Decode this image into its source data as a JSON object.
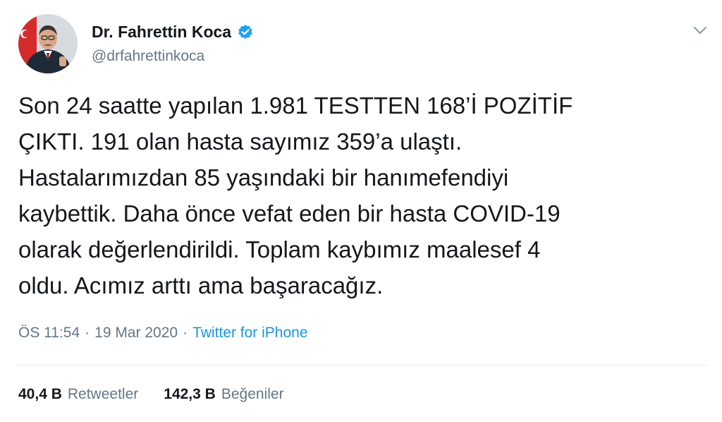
{
  "tweet": {
    "author_name": "Dr. Fahrettin Koca",
    "author_handle": "@drfahrettinkoca",
    "text": "Son 24 saatte yapılan 1.981 TESTTEN 168’İ POZİTİF\nÇIKTI. 191 olan hasta sayımız 359’a ulaştı.\nHastalarımızdan 85 yaşındaki bir hanımefendiyi\nkaybettik. Daha önce vefat eden bir hasta COVID-19\nolarak değerlendirildi. Toplam kaybımız maalesef 4\noldu. Acımız arttı ama başaracağız.",
    "time": "ÖS 11:54",
    "date": "19 Mar 2020",
    "separator": "·",
    "source": "Twitter for iPhone"
  },
  "stats": {
    "retweets_count": "40,4 B",
    "retweets_label": "Retweetler",
    "likes_count": "142,3 B",
    "likes_label": "Beğeniler"
  },
  "icons": {
    "verified": "verified-badge-icon",
    "more": "chevron-down-icon"
  },
  "colors": {
    "link": "#1b95e0",
    "secondary_text": "#657786",
    "verified": "#1da1f2"
  }
}
